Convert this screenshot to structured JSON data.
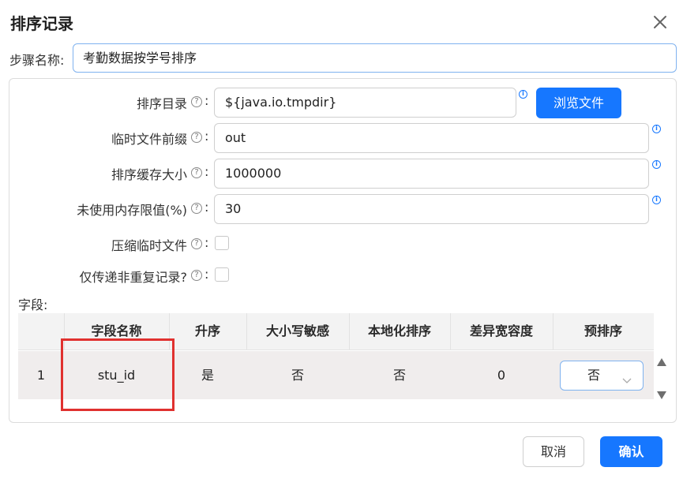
{
  "dialog": {
    "title": "排序记录",
    "close_icon": "close-icon"
  },
  "step_name": {
    "label": "步骤名称:",
    "value": "考勤数据按学号排序"
  },
  "form": {
    "sort_dir": {
      "label": "排序目录",
      "value": "${java.io.tmpdir}",
      "browse_label": "浏览文件"
    },
    "temp_prefix": {
      "label": "临时文件前缀",
      "value": "out"
    },
    "sort_buffer": {
      "label": "排序缓存大小",
      "value": "1000000"
    },
    "free_memory": {
      "label": "未使用内存限值(%)",
      "value": "30"
    },
    "compress_temp": {
      "label": "压缩临时文件",
      "checked": false
    },
    "unique_only": {
      "label": "仅传递非重复记录?",
      "checked": false
    },
    "colon": ":",
    "help_glyph": "?",
    "info_glyph": "i"
  },
  "fields": {
    "label": "字段:",
    "columns": [
      "",
      "字段名称",
      "升序",
      "大小写敏感",
      "本地化排序",
      "差异宽容度",
      "预排序"
    ],
    "rows": [
      {
        "index": "1",
        "name": "stu_id",
        "ascending": "是",
        "case_sensitive": "否",
        "localized": "否",
        "tolerance": "0",
        "presorted": "否"
      }
    ]
  },
  "footer": {
    "cancel_label": "取消",
    "ok_label": "确认"
  },
  "colors": {
    "primary": "#1677ff",
    "highlight_box": "#e0312f",
    "focus_border": "#7fb2ef"
  }
}
